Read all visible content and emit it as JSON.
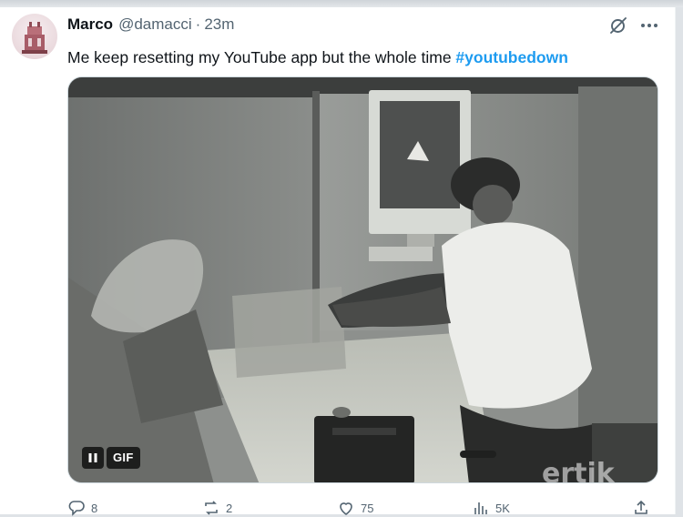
{
  "tweet": {
    "display_name": "Marco",
    "handle": "@damacci",
    "separator": "·",
    "timestamp": "23m",
    "text": "Me keep resetting my YouTube app but the whole time ",
    "hashtag": "#youtubedown",
    "media": {
      "type": "gif",
      "badge_label": "GIF",
      "control_icon": "pause-icon"
    },
    "actions": [
      {
        "name": "reply",
        "icon": "reply-icon",
        "count": "8"
      },
      {
        "name": "repost",
        "icon": "repost-icon",
        "count": "2"
      },
      {
        "name": "like",
        "icon": "heart-icon",
        "count": "75"
      },
      {
        "name": "views",
        "icon": "views-icon",
        "count": "5K"
      }
    ],
    "header_icons": [
      "grok-icon",
      "more-icon"
    ]
  },
  "colors": {
    "text_primary": "#0f1419",
    "text_secondary": "#536471",
    "hashtag": "#1d9bf0",
    "background": "#ffffff"
  }
}
